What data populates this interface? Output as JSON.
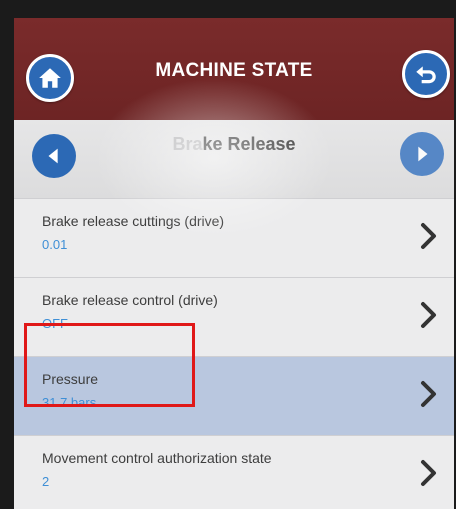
{
  "header": {
    "title": "MACHINE STATE",
    "home_icon": "home-icon",
    "back_icon": "return-icon",
    "color": "#6d2424"
  },
  "subnav": {
    "title_faded": "Bra",
    "title_main": "ke Release",
    "prev_icon": "chevron-left-icon",
    "next_icon": "chevron-right-icon"
  },
  "rows": [
    {
      "label": "Brake release cuttings (drive)",
      "value": "0.01"
    },
    {
      "label": "Brake release control (drive)",
      "value": "OFF"
    },
    {
      "label": "Pressure",
      "value": "31.7 bars"
    },
    {
      "label": "Movement control authorization state",
      "value": "2"
    }
  ],
  "selected_row_index": 2,
  "colors": {
    "accent": "#2c69b5",
    "value_text": "#3f8fd6",
    "highlight_box": "#e01818"
  }
}
